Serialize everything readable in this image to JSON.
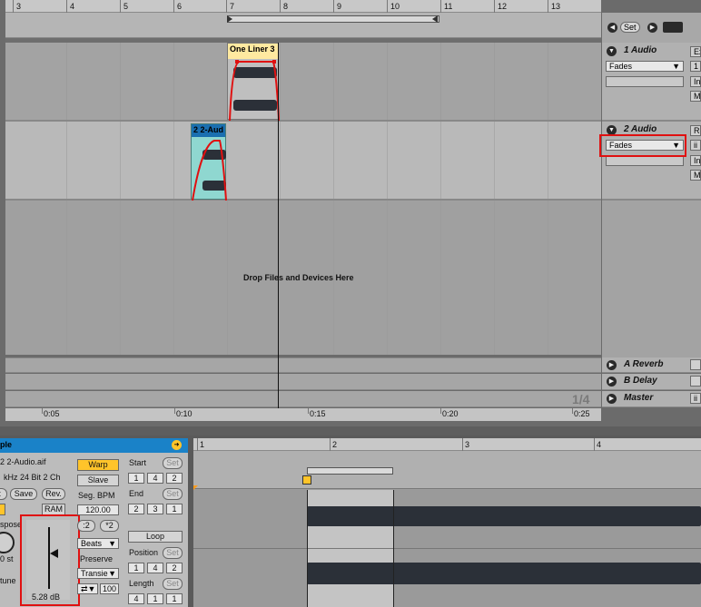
{
  "arrangement": {
    "bar_ruler": [
      "3",
      "4",
      "5",
      "6",
      "7",
      "8",
      "9",
      "10",
      "11",
      "12",
      "13"
    ],
    "time_ruler": [
      "0:05",
      "0:10",
      "0:15",
      "0:20",
      "0:25"
    ],
    "drop_text": "Drop Files and Devices Here",
    "page_indicator": "1/4",
    "set_label": "Set"
  },
  "tracks": [
    {
      "name": "1 Audio",
      "dropdown": "Fades",
      "clip": "One Liner 3",
      "side_labels": [
        "Ex",
        "1",
        "In",
        "M"
      ]
    },
    {
      "name": "2 Audio",
      "dropdown": "Fades",
      "clip": "2 2-Aud",
      "side_labels": [
        "Re",
        "ii",
        "In",
        "M"
      ]
    }
  ],
  "returns": [
    {
      "name": "A Reverb"
    },
    {
      "name": "B Delay"
    },
    {
      "name": "Master",
      "side": "ii"
    }
  ],
  "clip_view": {
    "title": "ple",
    "file_name": "2 2-Audio.aif",
    "file_info": "kHz 24 Bit 2 Ch",
    "edit_btn": "Edit",
    "save_btn": "Save",
    "rev_btn": "Rev.",
    "ram_btn": "RAM",
    "transpose_label": "spose",
    "transpose_val": "0 st",
    "detune_label": "tune",
    "gain_val": "5.28 dB",
    "warp_btn": "Warp",
    "slave_btn": "Slave",
    "seg_bpm_label": "Seg. BPM",
    "seg_bpm_val": "120.00",
    "half_btn": ":2",
    "double_btn": "*2",
    "beats_val": "Beats",
    "preserve_label": "Preserve",
    "transient_val": "Transie",
    "vol_val": "100",
    "start_label": "Start",
    "end_label": "End",
    "loop_btn": "Loop",
    "position_label": "Position",
    "length_label": "Length",
    "set_label": "Set",
    "start_vals": [
      "1",
      "4",
      "2"
    ],
    "end_vals": [
      "2",
      "3",
      "1"
    ],
    "position_vals": [
      "1",
      "4",
      "2"
    ],
    "length_vals": [
      "4",
      "1",
      "1"
    ]
  },
  "sample_ruler": [
    "1",
    "2",
    "3",
    "4"
  ]
}
